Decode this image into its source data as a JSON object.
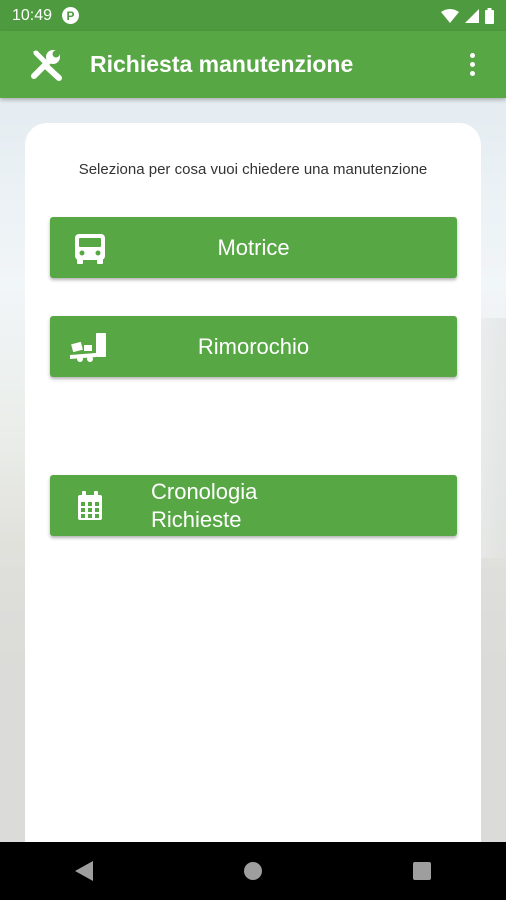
{
  "status_bar": {
    "time": "10:49",
    "notification_icon": "app-notification-icon"
  },
  "app_bar": {
    "title": "Richiesta manutenzione"
  },
  "content": {
    "subtitle": "Seleziona per cosa vuoi chiedere una manutenzione",
    "buttons": [
      {
        "label": "Motrice",
        "icon": "truck-front-icon"
      },
      {
        "label": "Rimorochio",
        "icon": "trailer-icon"
      },
      {
        "label_line1": "Cronologia",
        "label_line2": "Richieste",
        "icon": "calendar-icon"
      }
    ]
  },
  "colors": {
    "primary": "#58a745",
    "status": "#4e9a3e"
  }
}
